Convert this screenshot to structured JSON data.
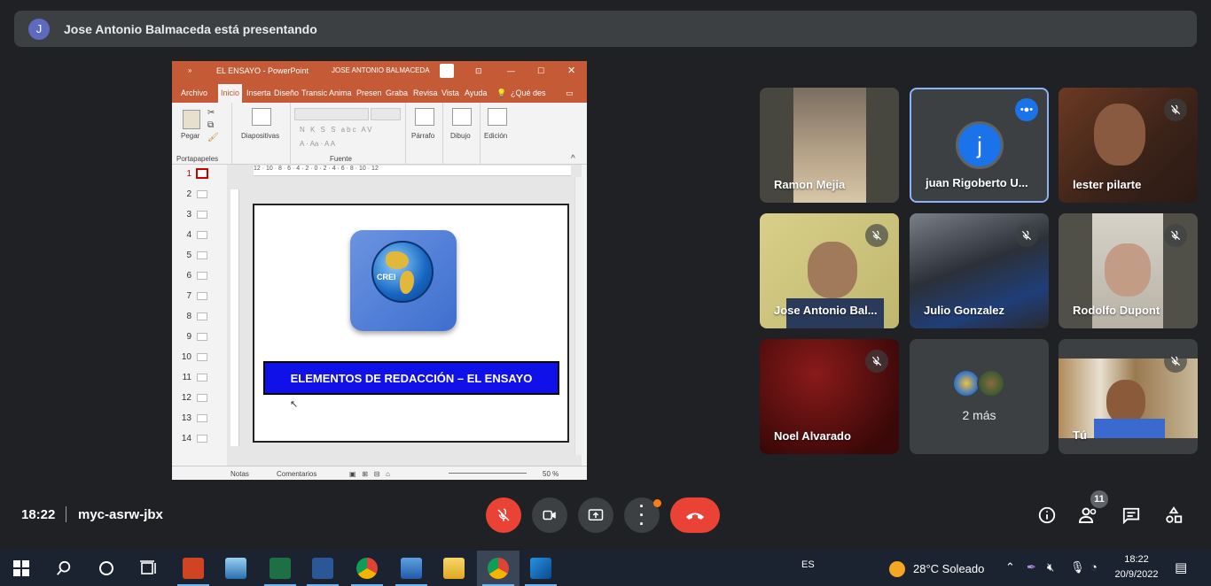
{
  "banner": {
    "avatar_letter": "J",
    "text": "Jose Antonio Balmaceda está presentando"
  },
  "ppt": {
    "title": "EL ENSAYO - PowerPoint",
    "author": "JOSE ANTONIO BALMACEDA",
    "tabs": [
      "Archivo",
      "Inicio",
      "Inserta",
      "Diseño",
      "Transic",
      "Anima",
      "Presen",
      "Graba",
      "Revisa",
      "Vista",
      "Ayuda",
      "¿Qué des"
    ],
    "active_tab": "Inicio",
    "ribbon": {
      "paste": "Pegar",
      "slides": "Diapositivas",
      "paragraph": "Párrafo",
      "drawing": "Dibujo",
      "editing": "Edición",
      "clipboard_group": "Portapapeles",
      "font_group": "Fuente",
      "font_tools": "N K S S abc AV"
    },
    "thumbnails": [
      "1",
      "2",
      "3",
      "4",
      "5",
      "6",
      "7",
      "8",
      "9",
      "10",
      "11",
      "12",
      "13",
      "14"
    ],
    "selected_slide": "1",
    "ruler_text": "12 · 10 · 8 · 6 · 4 · 2 · 0 · 2 · 4 · 6 · 8 · 10 · 12",
    "slide": {
      "logo_text": "CREI",
      "title": "ELEMENTOS DE REDACCIÓN – EL ENSAYO"
    },
    "status": {
      "notes": "Notas",
      "comments": "Comentarios",
      "zoom": "50 %"
    }
  },
  "participants": [
    {
      "name": "Ramon Mejia",
      "muted": false,
      "bg": "#5a5a52"
    },
    {
      "name": "juan Rigoberto U...",
      "muted": false,
      "avatar": "j",
      "speaking": true
    },
    {
      "name": "lester pilarte",
      "muted": true,
      "bg": "#4a2e22"
    },
    {
      "name": "Jose Antonio Bal...",
      "muted": true,
      "bg": "#c9c27a"
    },
    {
      "name": "Julio Gonzalez",
      "muted": true,
      "bg": "#3b3f4a"
    },
    {
      "name": "Rodolfo Dupont",
      "muted": true,
      "bg": "#6b6a62"
    },
    {
      "name": "Noel Alvarado",
      "muted": true,
      "bg": "#5a1010"
    },
    {
      "name": "2 más",
      "muted": false
    },
    {
      "name": "Tú",
      "muted": true,
      "bg": "#8c7a5c"
    }
  ],
  "meeting": {
    "time": "18:22",
    "code": "myc-asrw-jbx",
    "participant_count": "11"
  },
  "taskbar": {
    "language": "ES",
    "weather": "28°C  Soleado",
    "clock_time": "18:22",
    "clock_date": "20/9/2022"
  },
  "colors": {
    "end_call": "#ea4335",
    "mute_red": "#ea4335",
    "ppt_orange": "#c55a36",
    "slide_blue": "#1010e8",
    "speaking_blue": "#8ab4f8"
  }
}
